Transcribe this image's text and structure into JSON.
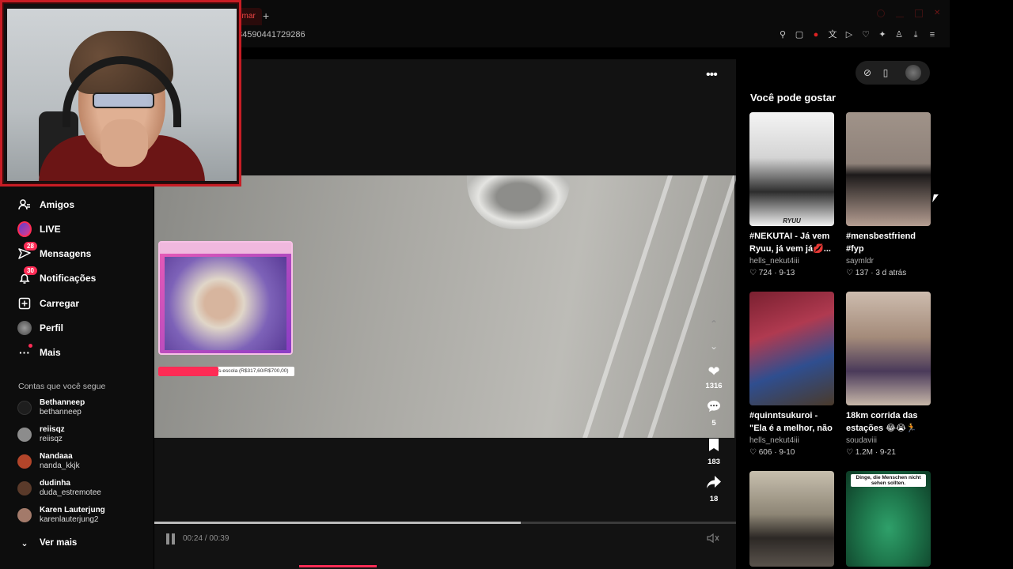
{
  "browser": {
    "active_tab_label": "umar",
    "new_tab_symbol": "+",
    "url_text": "34590441729286",
    "toolbar_icons": [
      "pin-icon",
      "crop-icon",
      "record-icon",
      "translate-icon",
      "play-icon",
      "heart-icon",
      "extensions-icon",
      "profile-icon",
      "download-icon",
      "menu-icon"
    ]
  },
  "sidebar": {
    "items": [
      {
        "label": "Amigos",
        "icon": "friends-icon"
      },
      {
        "label": "LIVE",
        "icon": "live-icon"
      },
      {
        "label": "Mensagens",
        "icon": "messages-icon",
        "badge": "28"
      },
      {
        "label": "Notificações",
        "icon": "bell-icon",
        "badge": "30"
      },
      {
        "label": "Carregar",
        "icon": "upload-icon"
      },
      {
        "label": "Perfil",
        "icon": "profile-icon"
      },
      {
        "label": "Mais",
        "icon": "more-icon"
      }
    ],
    "following_title": "Contas que você segue",
    "accounts": [
      {
        "name": "Bethanneep",
        "username": "bethanneep",
        "color": "#1e1e1e"
      },
      {
        "name": "reiisqz",
        "username": "reiisqz",
        "color": "#8c8c8c"
      },
      {
        "name": "Nandaaa",
        "username": "nanda_kkjk",
        "color": "#b2452a"
      },
      {
        "name": "dudinha",
        "username": "duda_estremotee",
        "color": "#5a3a2a"
      },
      {
        "name": "Karen Lauterjung",
        "username": "karenlauterjung2",
        "color": "#a37a6a"
      }
    ],
    "see_more": "Ver mais"
  },
  "video": {
    "overlay_goal_text": "s-escola (R$317,60/R$700,00)",
    "likes": "1316",
    "comments": "5",
    "saves": "183",
    "shares": "18",
    "current_time": "00:24",
    "duration": "00:39",
    "time_display": "00:24 / 00:39",
    "progress": 0.63
  },
  "suggestions": {
    "title": "Você pode gostar",
    "cards": [
      {
        "caption": "#NEKUTAI - Já vem Ryuu, já vem já💋...",
        "author": "hells_nekut4iii",
        "likes": "724",
        "date": "9-13",
        "thumb_text": "RYUU",
        "colors": [
          "#f2f2f2",
          "#4a4a4a"
        ]
      },
      {
        "caption": "#mensbestfriend #fyp",
        "author": "saymldr",
        "likes": "137",
        "date": "3 d atrás",
        "colors": [
          "#9c8e86",
          "#3a2c28"
        ]
      },
      {
        "caption": "#quinntsukuroi - \"Ela é a melhor, não te...",
        "author": "hells_nekut4iii",
        "likes": "606",
        "date": "9-10",
        "colors": [
          "#8a2a3a",
          "#2f4e8f"
        ]
      },
      {
        "caption": "18km corrida das estações 😂😭🏃",
        "author": "soudaviii",
        "likes": "1.2M",
        "date": "9-21",
        "colors": [
          "#c9b7a8",
          "#4a3a5a"
        ]
      },
      {
        "caption": "",
        "author": "",
        "likes": "",
        "date": "",
        "colors": [
          "#c7bfae",
          "#3a3530"
        ]
      },
      {
        "caption": "",
        "author": "",
        "likes": "",
        "date": "",
        "thumb_text": "Dinge, die Menschen nicht sehen sollten.",
        "colors": [
          "#1f7a4e",
          "#0d3a25"
        ]
      }
    ]
  }
}
